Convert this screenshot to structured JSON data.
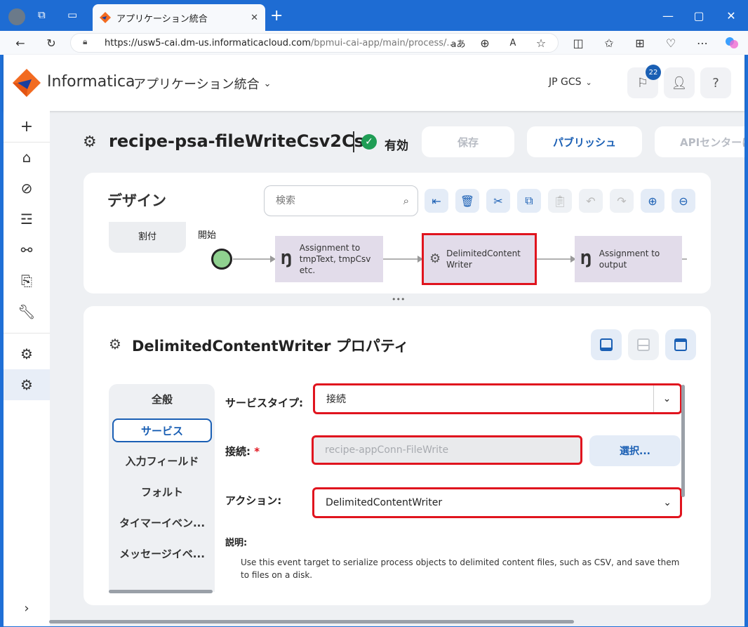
{
  "browser": {
    "tab_title": "アプリケーション統合",
    "url_host": "https://usw5-cai.dm-us.informaticacloud.com",
    "url_path": "/bpmui-cai-app/main/process/...",
    "new_tab": "+",
    "close_tab": "✕"
  },
  "app": {
    "brand": "Informatica",
    "product": "アプリケーション統合",
    "org": "JP GCS",
    "notif_count": "22",
    "help": "?"
  },
  "process": {
    "title": "recipe-psa-fileWriteCsv2Csv",
    "status": "有効",
    "save": "保存",
    "publish": "パブリッシュ",
    "api_center": "APIセンターに"
  },
  "design": {
    "title": "デザイン",
    "search_placeholder": "検索",
    "partial_node": "割付",
    "start_label": "開始",
    "nodes": [
      {
        "label": "Assignment to tmpText, tmpCsv etc."
      },
      {
        "label": "DelimitedContent Writer"
      },
      {
        "label": "Assignment to output"
      }
    ],
    "splitter": "•••"
  },
  "properties": {
    "title": "DelimitedContentWriter プロパティ",
    "tabs": [
      "全般",
      "サービス",
      "入力フィールド",
      "フォルト",
      "タイマーイベン...",
      "メッセージイベ..."
    ],
    "service_type_label": "サービスタイプ:",
    "service_type_value": "接続",
    "connection_label": "接続:",
    "required_mark": "*",
    "connection_value": "recipe-appConn-FileWrite",
    "select_button": "選択...",
    "action_label": "アクション:",
    "action_value": "DelimitedContentWriter",
    "description_label": "説明:",
    "description_text": "Use this event target to serialize process objects to delimited content files, such as CSV, and save them to files on a disk."
  },
  "colors": {
    "accent": "#1a5fb4",
    "highlight": "#e0141e",
    "node_fill": "#e2dcea",
    "start_node": "#8fd18f",
    "status_green": "#1f9d55"
  }
}
